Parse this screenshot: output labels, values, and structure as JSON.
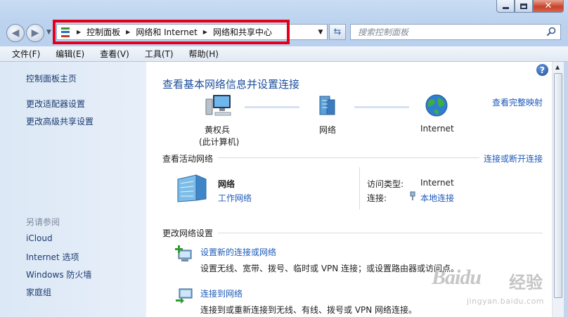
{
  "window": {
    "minimize_glyph": "—",
    "close_glyph": "✕"
  },
  "address_bar": {
    "crumbs": [
      "控制面板",
      "网络和 Internet",
      "网络和共享中心"
    ]
  },
  "search": {
    "placeholder": "搜索控制面板"
  },
  "menu": [
    "文件(F)",
    "编辑(E)",
    "查看(V)",
    "工具(T)",
    "帮助(H)"
  ],
  "sidebar": {
    "items": [
      "控制面板主页",
      "更改适配器设置",
      "更改高级共享设置"
    ],
    "see_also_heading": "另请参阅",
    "see_also": [
      "iCloud",
      "Internet 选项",
      "Windows 防火墙",
      "家庭组"
    ]
  },
  "main": {
    "title": "查看基本网络信息并设置连接",
    "full_map_link": "查看完整映射",
    "map": {
      "computer_name": "黄权兵",
      "computer_note": "(此计算机)",
      "network": "网络",
      "internet": "Internet"
    },
    "active_networks": {
      "heading": "查看活动网络",
      "connect_link": "连接或断开连接",
      "network_name": "网络",
      "network_type": "工作网络",
      "access_type_label": "访问类型:",
      "access_type_value": "Internet",
      "connection_label": "连接:",
      "connection_value": "本地连接"
    },
    "change_settings": {
      "heading": "更改网络设置",
      "tasks": [
        {
          "title": "设置新的连接或网络",
          "desc": "设置无线、宽带、拨号、临时或 VPN 连接；或设置路由器或访问点。"
        },
        {
          "title": "连接到网络",
          "desc": "连接到或重新连接到无线、有线、拨号或 VPN 网络连接。"
        }
      ]
    }
  },
  "watermark": {
    "logo": "Baidu",
    "cn": "经验",
    "url": "jingyan.baidu.com"
  },
  "colors": {
    "link": "#1d5ab8",
    "title": "#1c4f9c",
    "highlight": "#e4001b",
    "sidebar_link": "#1b3b6f"
  }
}
